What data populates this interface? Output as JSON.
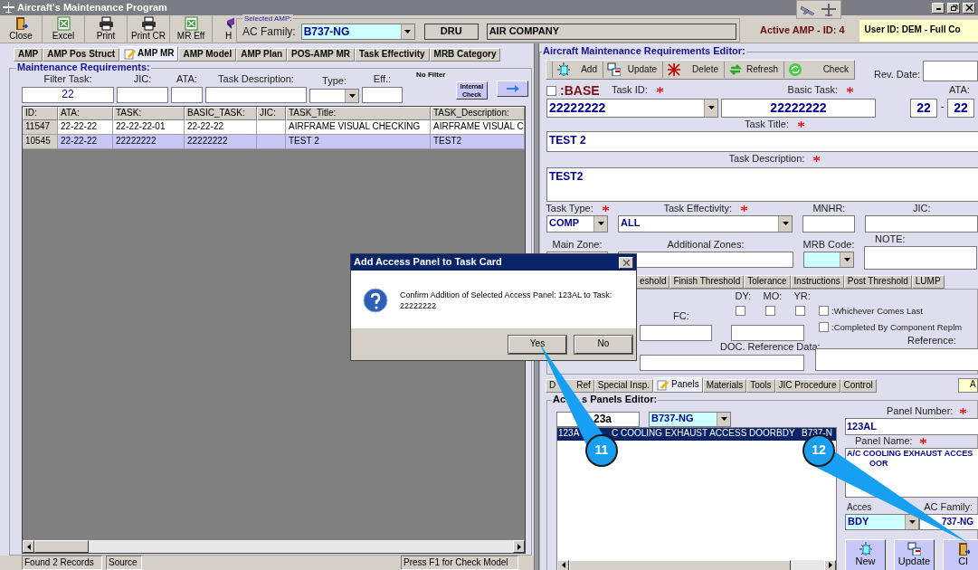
{
  "window": {
    "title": "Aircraft's Maintenance Program"
  },
  "toolbar": [
    {
      "label": "Close",
      "kind": "exit"
    },
    {
      "label": "Excel",
      "kind": "sheet"
    },
    {
      "label": "Print",
      "kind": "print"
    },
    {
      "label": "Print CR",
      "kind": "print"
    },
    {
      "label": "MR Eff",
      "kind": "sheet"
    },
    {
      "label": "H",
      "kind": "book"
    }
  ],
  "selected_amp": {
    "title": "Selected AMP:",
    "ac_family_label": "AC Family:",
    "ac_family": "B737-NG",
    "dru_button": "DRU",
    "company": "AIR COMPANY"
  },
  "active_amp": "Active AMP - ID: 4",
  "user_info": "User ID: DEM - Full Co",
  "left_tabs": [
    {
      "label": "AMP",
      "selected": false
    },
    {
      "label": "AMP Pos Struct",
      "selected": false
    },
    {
      "label": "AMP MR",
      "selected": true
    },
    {
      "label": "AMP Model",
      "selected": false
    },
    {
      "label": "AMP Plan",
      "selected": false
    },
    {
      "label": "POS-AMP MR",
      "selected": false
    },
    {
      "label": "Task Effectivity",
      "selected": false
    },
    {
      "label": "MRB Category",
      "selected": false
    }
  ],
  "maintenance_requirements": {
    "title": "Maintenance Requirements:",
    "filter_state": "No Filter",
    "internal_check_button": "Internal Check",
    "filters": [
      {
        "label": "Filter Task:",
        "value": "22",
        "kind": "text"
      },
      {
        "label": "JIC:",
        "kind": "text"
      },
      {
        "label": "ATA:",
        "kind": "text"
      },
      {
        "label": "Task Description:",
        "kind": "text"
      },
      {
        "label": "Type:",
        "kind": "combo"
      },
      {
        "label": "Eff.:",
        "kind": "text"
      }
    ]
  },
  "table": {
    "columns": [
      "ID:",
      "ATA:",
      "TASK:",
      "BASIC_TASK:",
      "JIC:",
      "TASK_Title:",
      "TASK_Description:"
    ],
    "rows": [
      {
        "id": "11547",
        "ata": "22-22-22",
        "task": "22-22-22-01",
        "basic_task": "22-22-22",
        "title": "AIRFRAME VISUAL CHECKING",
        "description": "AIRFRAME VISUAL C",
        "selected": false
      },
      {
        "id": "10545",
        "ata": "22-22-22",
        "task": "22222222",
        "basic_task": "22222222",
        "title": "TEST 2",
        "description": "TEST2",
        "selected": true
      }
    ]
  },
  "status_bar": [
    "Found 2 Records",
    "Source",
    "Press F1 for Check Model"
  ],
  "editor": {
    "title": "Aircraft Maintenance Requirements Editor:",
    "toolbar": [
      {
        "label": "Add",
        "kind": "add"
      },
      {
        "label": "Update",
        "kind": "update"
      },
      {
        "label": "Delete",
        "kind": "delete"
      },
      {
        "label": "Refresh",
        "kind": "refresh"
      },
      {
        "label": "Check",
        "kind": "check"
      }
    ],
    "rev_date_label": "Rev. Date:",
    "base": {
      "label": ":BASE",
      "checked": false
    },
    "task_id": {
      "label": "Task ID:",
      "required": true,
      "value": "22222222"
    },
    "basic_task": {
      "label": "Basic Task:",
      "required": true,
      "value": "22222222"
    },
    "ata": {
      "label": "ATA:",
      "values": [
        "22",
        "22"
      ],
      "separator": "-"
    },
    "task_title": {
      "label": "Task Title:",
      "required": true,
      "value": "TEST 2"
    },
    "task_description": {
      "label": "Task Description:",
      "required": true,
      "value": "TEST2"
    },
    "task_type": {
      "label": "Task Type:",
      "required": true,
      "value": "COMP"
    },
    "task_effectivity": {
      "label": "Task Effectivity:",
      "required": true,
      "value": "ALL"
    },
    "mnhr": {
      "label": "MNHR:"
    },
    "jic": {
      "label": "JIC:"
    },
    "main_zone": {
      "label": "Main Zone:"
    },
    "additional_zones": {
      "label": "Additional Zones:"
    },
    "mrb_code": {
      "label": "MRB Code:"
    },
    "note": {
      "label": "NOTE:"
    }
  },
  "threshold_tabs": [
    {
      "label": "eshold",
      "selected": false
    },
    {
      "label": "Finish Threshold",
      "selected": false
    },
    {
      "label": "Tolerance",
      "selected": false
    },
    {
      "label": "Instructions",
      "selected": false
    },
    {
      "label": "Post Threshold",
      "selected": false
    },
    {
      "label": "LUMP",
      "selected": false
    }
  ],
  "threshold": {
    "periods": [
      {
        "label": "DY:",
        "checked": false
      },
      {
        "label": "MO:",
        "checked": false
      },
      {
        "label": "YR:",
        "checked": false
      }
    ],
    "fc_label": "FC:",
    "doc_reference_label": "DOC. Reference Data:",
    "reference_label": "Reference:",
    "options": [
      {
        "label": ":Whichever Comes Last",
        "checked": false
      },
      {
        "label": ":Completed By Component Replm",
        "checked": false
      }
    ]
  },
  "detail_tabs": [
    {
      "label": "D",
      "label_end": "Ref",
      "selected": false
    },
    {
      "label": "Special Insp.",
      "selected": false
    },
    {
      "label": "Panels",
      "selected": true
    },
    {
      "label": "Materials",
      "selected": false
    },
    {
      "label": "Tools",
      "selected": false
    },
    {
      "label": "JIC Procedure",
      "selected": false
    },
    {
      "label": "Control",
      "selected": false
    }
  ],
  "side_tab": "A",
  "access_panels": {
    "title_start": "Ac",
    "title_end": "s Panels Editor:",
    "filter": "23a",
    "ac_family": "B737-NG",
    "list": [
      {
        "cells": [
          "123A",
          "C COOLING EXHAUST ACCESS DOOR",
          "BDY",
          "B737-N"
        ],
        "selected": true
      }
    ],
    "panel_number_label": "Panel Number:",
    "panel_number": "123AL",
    "panel_name_label": "Panel Name:",
    "panel_name_lines": [
      "A/C COOLING EXHAUST ACCES",
      "OOR"
    ],
    "access_label": "Acces",
    "ac_family_label": "AC Family:",
    "access": "BDY",
    "family_value": "737-NG",
    "buttons": [
      {
        "label": "New",
        "kind": "new"
      },
      {
        "label": "Update",
        "kind": "update"
      },
      {
        "label": "Cl",
        "kind": "exit"
      }
    ]
  },
  "dialog": {
    "title": "Add Access Panel to Task Card",
    "message": "Confirm Addition of Selected Access Panel: 123AL to Task: 22222222",
    "buttons": [
      "Yes",
      "No"
    ]
  },
  "callouts": [
    {
      "label": "11"
    },
    {
      "label": "12"
    }
  ]
}
